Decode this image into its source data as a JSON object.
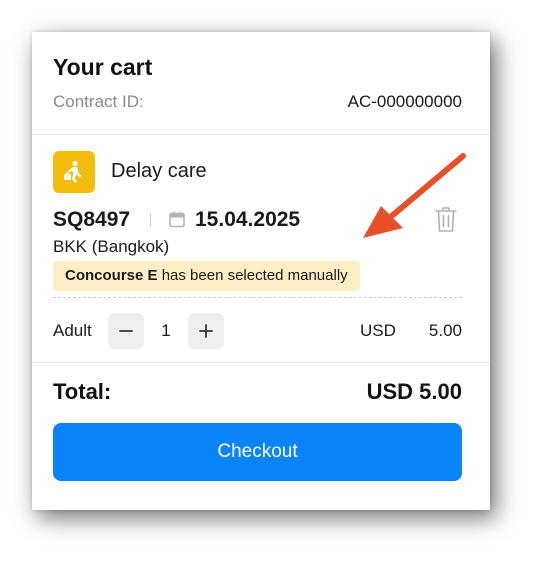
{
  "cart": {
    "title": "Your cart",
    "contract_label": "Contract ID:",
    "contract_id": "AC-000000000"
  },
  "item": {
    "icon": "person-with-suitcase-icon",
    "icon_color": "#f2bd0c",
    "name": "Delay care",
    "flight_number": "SQ8497",
    "date": "15.04.2025",
    "airport": "BKK (Bangkok)",
    "notice_bold": "Concourse E",
    "notice_rest": " has been selected manually",
    "notice_color": "#fcefc6",
    "passenger_type": "Adult",
    "quantity": "1",
    "currency": "USD",
    "price": "5.00"
  },
  "total": {
    "label": "Total:",
    "value": "USD 5.00"
  },
  "checkout_label": "Checkout",
  "colors": {
    "accent": "#0a84f8",
    "annotation_arrow": "#e8502a"
  }
}
